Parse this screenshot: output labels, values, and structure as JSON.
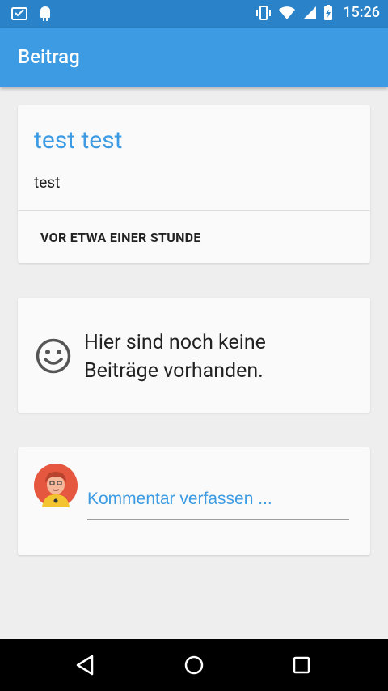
{
  "status_bar": {
    "time": "15:26",
    "left_icons": [
      "inbox-check-icon",
      "android-icon"
    ],
    "right_icons": [
      "vibrate-icon",
      "wifi-icon",
      "signal-icon",
      "battery-charging-icon"
    ],
    "background": "#2a83c8"
  },
  "app_bar": {
    "title": "Beitrag",
    "background": "#3c9be3"
  },
  "post": {
    "title": "test test",
    "body": "test",
    "time": "VOR ETWA EINER STUNDE"
  },
  "empty_state": {
    "icon": "smiley-icon",
    "line1": "Hier sind noch keine",
    "line2": "Beiträge vorhanden."
  },
  "comment": {
    "avatar": "user-avatar",
    "placeholder": "Kommentar verfassen ..."
  },
  "nav_bar": {
    "buttons": [
      "back-icon",
      "home-icon",
      "recents-icon"
    ]
  },
  "colors": {
    "accent": "#3c9be3",
    "background": "#eeeeee",
    "card": "#fafafa"
  }
}
